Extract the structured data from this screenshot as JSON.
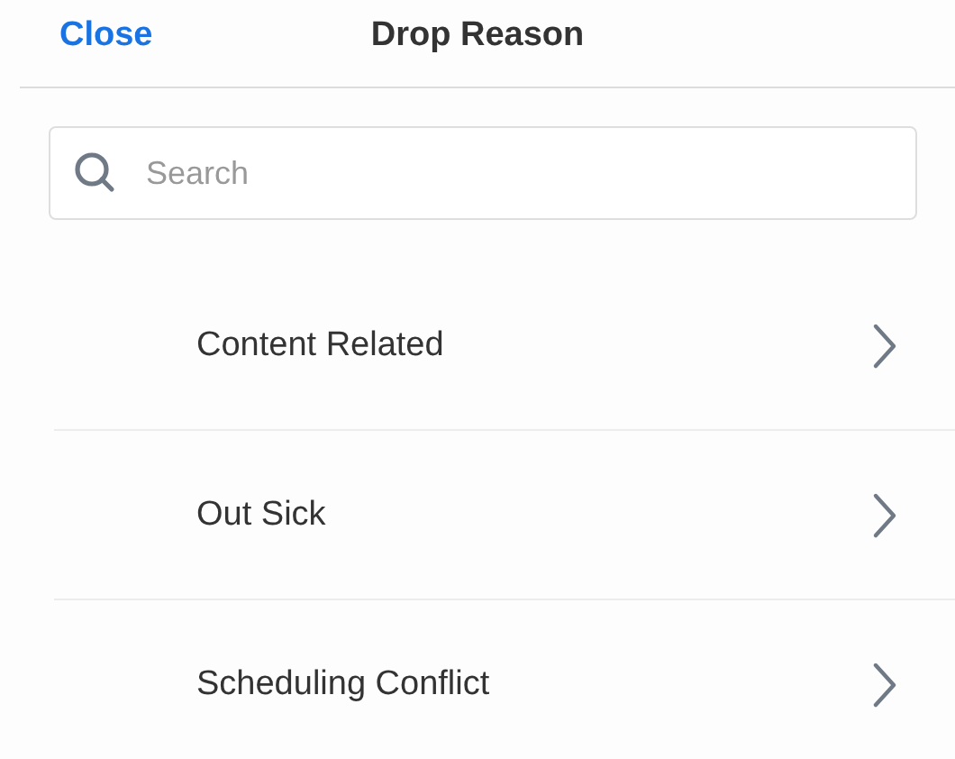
{
  "header": {
    "close_label": "Close",
    "title": "Drop Reason"
  },
  "search": {
    "placeholder": "Search"
  },
  "reasons": [
    {
      "label": "Content Related"
    },
    {
      "label": "Out Sick"
    },
    {
      "label": "Scheduling Conflict"
    }
  ]
}
